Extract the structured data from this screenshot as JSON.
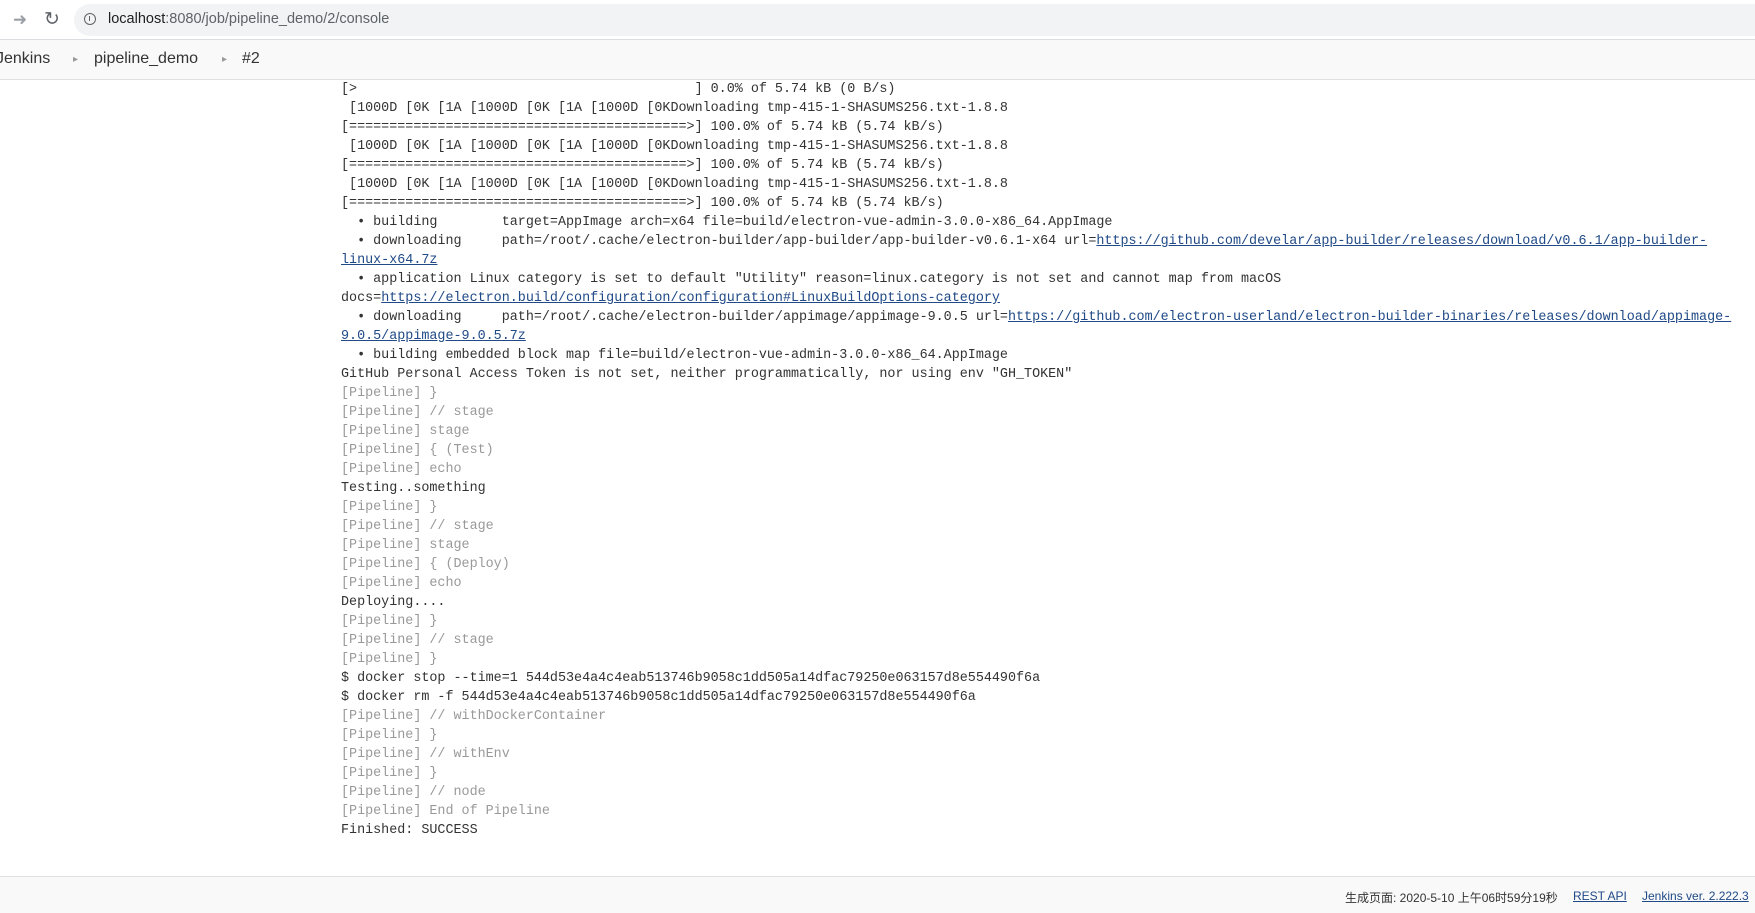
{
  "browser": {
    "url_host": "localhost",
    "url_path": ":8080/job/pipeline_demo/2/console"
  },
  "breadcrumbs": [
    "Jenkins",
    "pipeline_demo",
    "#2"
  ],
  "console_lines": [
    {
      "text": "[>                                          ] 0.0% of 5.74 kB (0 B/s)"
    },
    {
      "text": " [1000D [0K [1A [1000D [0K [1A [1000D [0KDownloading tmp-415-1-SHASUMS256.txt-1.8.8"
    },
    {
      "text": "[==========================================>] 100.0% of 5.74 kB (5.74 kB/s)"
    },
    {
      "text": " [1000D [0K [1A [1000D [0K [1A [1000D [0KDownloading tmp-415-1-SHASUMS256.txt-1.8.8"
    },
    {
      "text": "[==========================================>] 100.0% of 5.74 kB (5.74 kB/s)"
    },
    {
      "text": " [1000D [0K [1A [1000D [0K [1A [1000D [0KDownloading tmp-415-1-SHASUMS256.txt-1.8.8"
    },
    {
      "text": "[==========================================>] 100.0% of 5.74 kB (5.74 kB/s)"
    },
    {
      "text": "  • building        target=AppImage arch=x64 file=build/electron-vue-admin-3.0.0-x86_64.AppImage"
    },
    {
      "text": "  • downloading     path=/root/.cache/electron-builder/app-builder/app-builder-v0.6.1-x64 url=",
      "link": "https://github.com/develar/app-builder/releases/download/v0.6.1/app-builder-"
    },
    {
      "text": "",
      "link": "linux-x64.7z"
    },
    {
      "text": "  • application Linux category is set to default \"Utility\" reason=linux.category is not set and cannot map from macOS"
    },
    {
      "text": "docs=",
      "link": "https://electron.build/configuration/configuration#LinuxBuildOptions-category"
    },
    {
      "text": "  • downloading     path=/root/.cache/electron-builder/appimage/appimage-9.0.5 url=",
      "link": "https://github.com/electron-userland/electron-builder-binaries/releases/download/appimage-"
    },
    {
      "text": "",
      "link": "9.0.5/appimage-9.0.5.7z"
    },
    {
      "text": "  • building embedded block map file=build/electron-vue-admin-3.0.0-x86_64.AppImage"
    },
    {
      "text": "GitHub Personal Access Token is not set, neither programmatically, nor using env \"GH_TOKEN\""
    },
    {
      "text": "[Pipeline] }",
      "pipeline": true
    },
    {
      "text": "[Pipeline] // stage",
      "pipeline": true
    },
    {
      "text": "[Pipeline] stage",
      "pipeline": true
    },
    {
      "text": "[Pipeline] { (Test)",
      "pipeline": true
    },
    {
      "text": "[Pipeline] echo",
      "pipeline": true
    },
    {
      "text": "Testing..something"
    },
    {
      "text": "[Pipeline] }",
      "pipeline": true
    },
    {
      "text": "[Pipeline] // stage",
      "pipeline": true
    },
    {
      "text": "[Pipeline] stage",
      "pipeline": true
    },
    {
      "text": "[Pipeline] { (Deploy)",
      "pipeline": true
    },
    {
      "text": "[Pipeline] echo",
      "pipeline": true
    },
    {
      "text": "Deploying...."
    },
    {
      "text": "[Pipeline] }",
      "pipeline": true
    },
    {
      "text": "[Pipeline] // stage",
      "pipeline": true
    },
    {
      "text": "[Pipeline] }",
      "pipeline": true
    },
    {
      "text": "$ docker stop --time=1 544d53e4a4c4eab513746b9058c1dd505a14dfac79250e063157d8e554490f6a"
    },
    {
      "text": "$ docker rm -f 544d53e4a4c4eab513746b9058c1dd505a14dfac79250e063157d8e554490f6a"
    },
    {
      "text": "[Pipeline] // withDockerContainer",
      "pipeline": true
    },
    {
      "text": "[Pipeline] }",
      "pipeline": true
    },
    {
      "text": "[Pipeline] // withEnv",
      "pipeline": true
    },
    {
      "text": "[Pipeline] }",
      "pipeline": true
    },
    {
      "text": "[Pipeline] // node",
      "pipeline": true
    },
    {
      "text": "[Pipeline] End of Pipeline",
      "pipeline": true
    },
    {
      "text": "Finished: SUCCESS"
    }
  ],
  "footer": {
    "generated": "生成页面: 2020-5-10 上午06时59分19秒",
    "rest_api": "REST API",
    "version": "Jenkins ver. 2.222.3"
  },
  "colors": {
    "link": "#204a87",
    "pipeline_text": "#9a9999",
    "console_text": "#333333"
  }
}
